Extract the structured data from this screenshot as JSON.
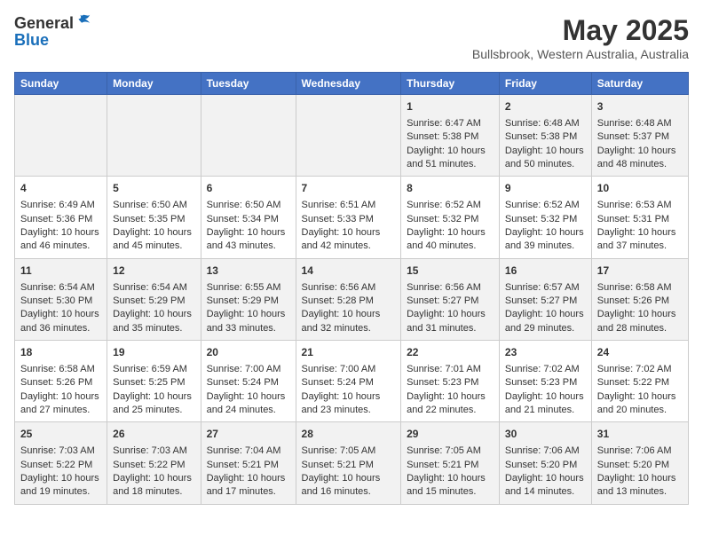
{
  "header": {
    "logo_line1": "General",
    "logo_line2": "Blue",
    "title": "May 2025",
    "subtitle": "Bullsbrook, Western Australia, Australia"
  },
  "days_of_week": [
    "Sunday",
    "Monday",
    "Tuesday",
    "Wednesday",
    "Thursday",
    "Friday",
    "Saturday"
  ],
  "weeks": [
    [
      {
        "day": "",
        "content": ""
      },
      {
        "day": "",
        "content": ""
      },
      {
        "day": "",
        "content": ""
      },
      {
        "day": "",
        "content": ""
      },
      {
        "day": "1",
        "content": "Sunrise: 6:47 AM\nSunset: 5:38 PM\nDaylight: 10 hours and 51 minutes."
      },
      {
        "day": "2",
        "content": "Sunrise: 6:48 AM\nSunset: 5:38 PM\nDaylight: 10 hours and 50 minutes."
      },
      {
        "day": "3",
        "content": "Sunrise: 6:48 AM\nSunset: 5:37 PM\nDaylight: 10 hours and 48 minutes."
      }
    ],
    [
      {
        "day": "4",
        "content": "Sunrise: 6:49 AM\nSunset: 5:36 PM\nDaylight: 10 hours and 46 minutes."
      },
      {
        "day": "5",
        "content": "Sunrise: 6:50 AM\nSunset: 5:35 PM\nDaylight: 10 hours and 45 minutes."
      },
      {
        "day": "6",
        "content": "Sunrise: 6:50 AM\nSunset: 5:34 PM\nDaylight: 10 hours and 43 minutes."
      },
      {
        "day": "7",
        "content": "Sunrise: 6:51 AM\nSunset: 5:33 PM\nDaylight: 10 hours and 42 minutes."
      },
      {
        "day": "8",
        "content": "Sunrise: 6:52 AM\nSunset: 5:32 PM\nDaylight: 10 hours and 40 minutes."
      },
      {
        "day": "9",
        "content": "Sunrise: 6:52 AM\nSunset: 5:32 PM\nDaylight: 10 hours and 39 minutes."
      },
      {
        "day": "10",
        "content": "Sunrise: 6:53 AM\nSunset: 5:31 PM\nDaylight: 10 hours and 37 minutes."
      }
    ],
    [
      {
        "day": "11",
        "content": "Sunrise: 6:54 AM\nSunset: 5:30 PM\nDaylight: 10 hours and 36 minutes."
      },
      {
        "day": "12",
        "content": "Sunrise: 6:54 AM\nSunset: 5:29 PM\nDaylight: 10 hours and 35 minutes."
      },
      {
        "day": "13",
        "content": "Sunrise: 6:55 AM\nSunset: 5:29 PM\nDaylight: 10 hours and 33 minutes."
      },
      {
        "day": "14",
        "content": "Sunrise: 6:56 AM\nSunset: 5:28 PM\nDaylight: 10 hours and 32 minutes."
      },
      {
        "day": "15",
        "content": "Sunrise: 6:56 AM\nSunset: 5:27 PM\nDaylight: 10 hours and 31 minutes."
      },
      {
        "day": "16",
        "content": "Sunrise: 6:57 AM\nSunset: 5:27 PM\nDaylight: 10 hours and 29 minutes."
      },
      {
        "day": "17",
        "content": "Sunrise: 6:58 AM\nSunset: 5:26 PM\nDaylight: 10 hours and 28 minutes."
      }
    ],
    [
      {
        "day": "18",
        "content": "Sunrise: 6:58 AM\nSunset: 5:26 PM\nDaylight: 10 hours and 27 minutes."
      },
      {
        "day": "19",
        "content": "Sunrise: 6:59 AM\nSunset: 5:25 PM\nDaylight: 10 hours and 25 minutes."
      },
      {
        "day": "20",
        "content": "Sunrise: 7:00 AM\nSunset: 5:24 PM\nDaylight: 10 hours and 24 minutes."
      },
      {
        "day": "21",
        "content": "Sunrise: 7:00 AM\nSunset: 5:24 PM\nDaylight: 10 hours and 23 minutes."
      },
      {
        "day": "22",
        "content": "Sunrise: 7:01 AM\nSunset: 5:23 PM\nDaylight: 10 hours and 22 minutes."
      },
      {
        "day": "23",
        "content": "Sunrise: 7:02 AM\nSunset: 5:23 PM\nDaylight: 10 hours and 21 minutes."
      },
      {
        "day": "24",
        "content": "Sunrise: 7:02 AM\nSunset: 5:22 PM\nDaylight: 10 hours and 20 minutes."
      }
    ],
    [
      {
        "day": "25",
        "content": "Sunrise: 7:03 AM\nSunset: 5:22 PM\nDaylight: 10 hours and 19 minutes."
      },
      {
        "day": "26",
        "content": "Sunrise: 7:03 AM\nSunset: 5:22 PM\nDaylight: 10 hours and 18 minutes."
      },
      {
        "day": "27",
        "content": "Sunrise: 7:04 AM\nSunset: 5:21 PM\nDaylight: 10 hours and 17 minutes."
      },
      {
        "day": "28",
        "content": "Sunrise: 7:05 AM\nSunset: 5:21 PM\nDaylight: 10 hours and 16 minutes."
      },
      {
        "day": "29",
        "content": "Sunrise: 7:05 AM\nSunset: 5:21 PM\nDaylight: 10 hours and 15 minutes."
      },
      {
        "day": "30",
        "content": "Sunrise: 7:06 AM\nSunset: 5:20 PM\nDaylight: 10 hours and 14 minutes."
      },
      {
        "day": "31",
        "content": "Sunrise: 7:06 AM\nSunset: 5:20 PM\nDaylight: 10 hours and 13 minutes."
      }
    ]
  ]
}
